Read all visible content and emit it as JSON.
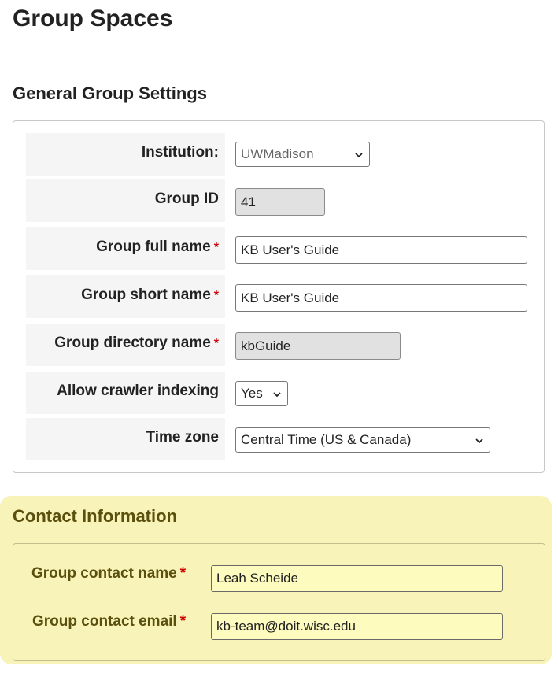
{
  "page": {
    "title": "Group Spaces"
  },
  "general": {
    "section_title": "General Group Settings",
    "institution": {
      "label": "Institution:",
      "value": "UWMadison"
    },
    "group_id": {
      "label": "Group ID",
      "value": "41"
    },
    "full_name": {
      "label": "Group full name",
      "required": "*",
      "value": "KB User's Guide"
    },
    "short_name": {
      "label": "Group short name",
      "required": "*",
      "value": "KB User's Guide"
    },
    "directory_name": {
      "label": "Group directory name",
      "required": "*",
      "value": "kbGuide"
    },
    "crawler": {
      "label": "Allow crawler indexing",
      "value": "Yes"
    },
    "time_zone": {
      "label": "Time zone",
      "value": "Central Time (US & Canada)"
    }
  },
  "contact": {
    "section_title": "Contact Information",
    "name": {
      "label": "Group contact name",
      "required": "*",
      "value": "Leah Scheide"
    },
    "email": {
      "label": "Group contact email",
      "required": "*",
      "value": "kb-team@doit.wisc.edu"
    }
  },
  "colors": {
    "required": "#cc0000",
    "contact_panel": "#f8f3b8",
    "contact_text": "#5a4f0c",
    "readonly_field": "#e1e1e1"
  },
  "icons": {
    "select_arrow": "chevron-down-icon"
  }
}
